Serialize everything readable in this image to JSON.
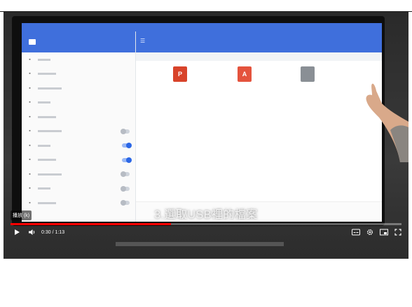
{
  "video": {
    "caption": "3.選取USB裡的檔案",
    "chip_label": "播放 (k)",
    "time": "0:30 / 1:13",
    "progress": 0.41
  },
  "screen": {
    "drawer_rows": 12,
    "drawer_toggles": [
      false,
      false,
      false,
      false,
      false,
      false,
      true,
      true,
      false,
      false,
      false
    ],
    "files": [
      {
        "icon": "ppt-file-icon",
        "ext": "P"
      },
      {
        "icon": "pdf-file-icon",
        "ext": "A"
      },
      {
        "icon": "video-file-icon",
        "ext": ""
      }
    ]
  },
  "colors": {
    "accent_blue": "#3f6fdc",
    "progress_red": "#ff0000"
  }
}
